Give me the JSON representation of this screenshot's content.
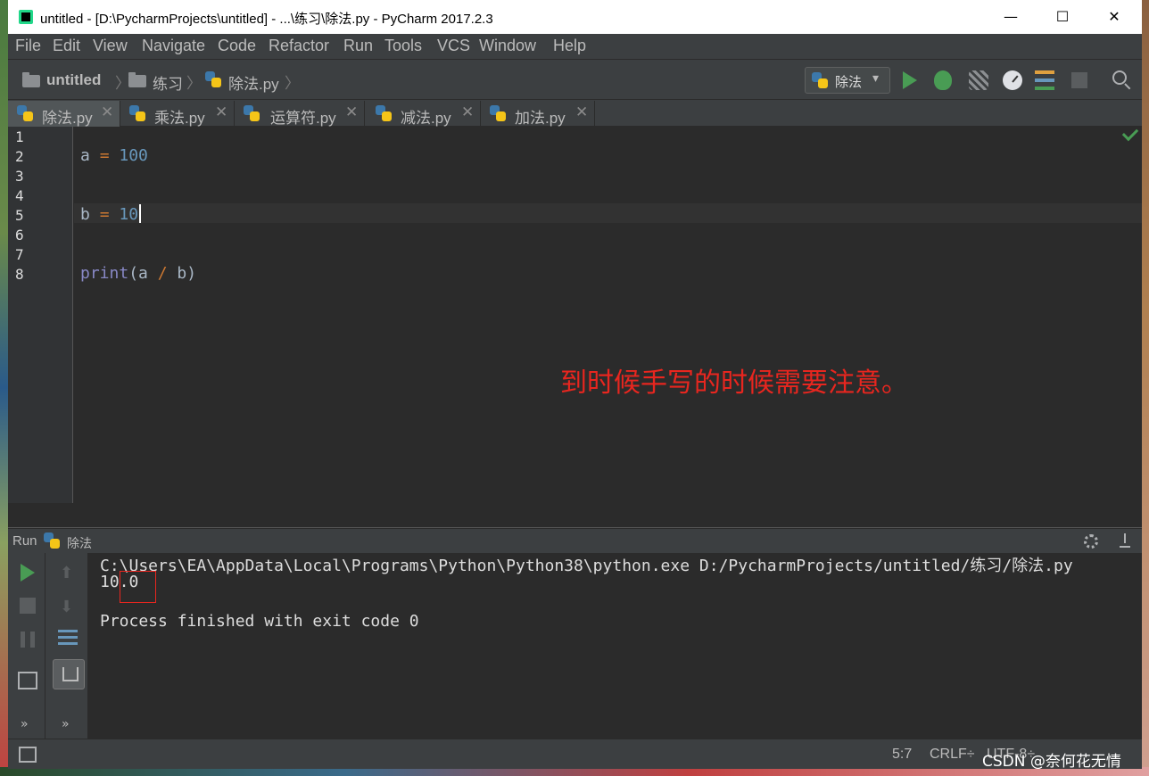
{
  "window": {
    "title": "untitled - [D:\\PycharmProjects\\untitled] - ...\\练习\\除法.py - PyCharm 2017.2.3",
    "controls": {
      "minimize": "—",
      "maximize": "☐",
      "close": "✕"
    }
  },
  "menu": [
    "File",
    "Edit",
    "View",
    "Navigate",
    "Code",
    "Refactor",
    "Run",
    "Tools",
    "VCS",
    "Window",
    "Help"
  ],
  "breadcrumb": [
    "untitled",
    "练习",
    "除法.py"
  ],
  "breadcrumb_separator": "〉",
  "run_config": {
    "name": "除法",
    "arrow": "▾"
  },
  "tabs": [
    {
      "label": "除法.py",
      "active": true
    },
    {
      "label": "乘法.py",
      "active": false
    },
    {
      "label": "运算符.py",
      "active": false
    },
    {
      "label": "减法.py",
      "active": false
    },
    {
      "label": "加法.py",
      "active": false
    }
  ],
  "tab_close": "✕",
  "editor": {
    "line_numbers": [
      "1",
      "2",
      "3",
      "4",
      "5",
      "6",
      "7",
      "8"
    ],
    "lines": {
      "l2": {
        "var": "a",
        "op": "=",
        "val": "100"
      },
      "l5": {
        "var": "b",
        "op": "=",
        "val": "10"
      },
      "l8": {
        "fn": "print",
        "open": "(a ",
        "op": "/",
        "close": " b)"
      }
    },
    "annotation": "到时候手写的时候需要注意。"
  },
  "run_panel": {
    "title": "Run",
    "config_name": "除法",
    "console": [
      "C:\\Users\\EA\\AppData\\Local\\Programs\\Python\\Python38\\python.exe D:/PycharmProjects/untitled/练习/除法.py",
      "10.0",
      "",
      "Process finished with exit code 0"
    ],
    "up_arrow": "⬆",
    "down_arrow": "⬇",
    "more": "»"
  },
  "status_bar": {
    "position": "5:7",
    "line_separator": "CRLF÷",
    "encoding": "UTF-8÷",
    "watermark": "CSDN @奈何花无情"
  },
  "colors": {
    "editor_bg": "#2b2b2b",
    "number": "#6897bb",
    "operator": "#cc7832",
    "annotation_red": "#e8261f",
    "run_green": "#499c54"
  }
}
